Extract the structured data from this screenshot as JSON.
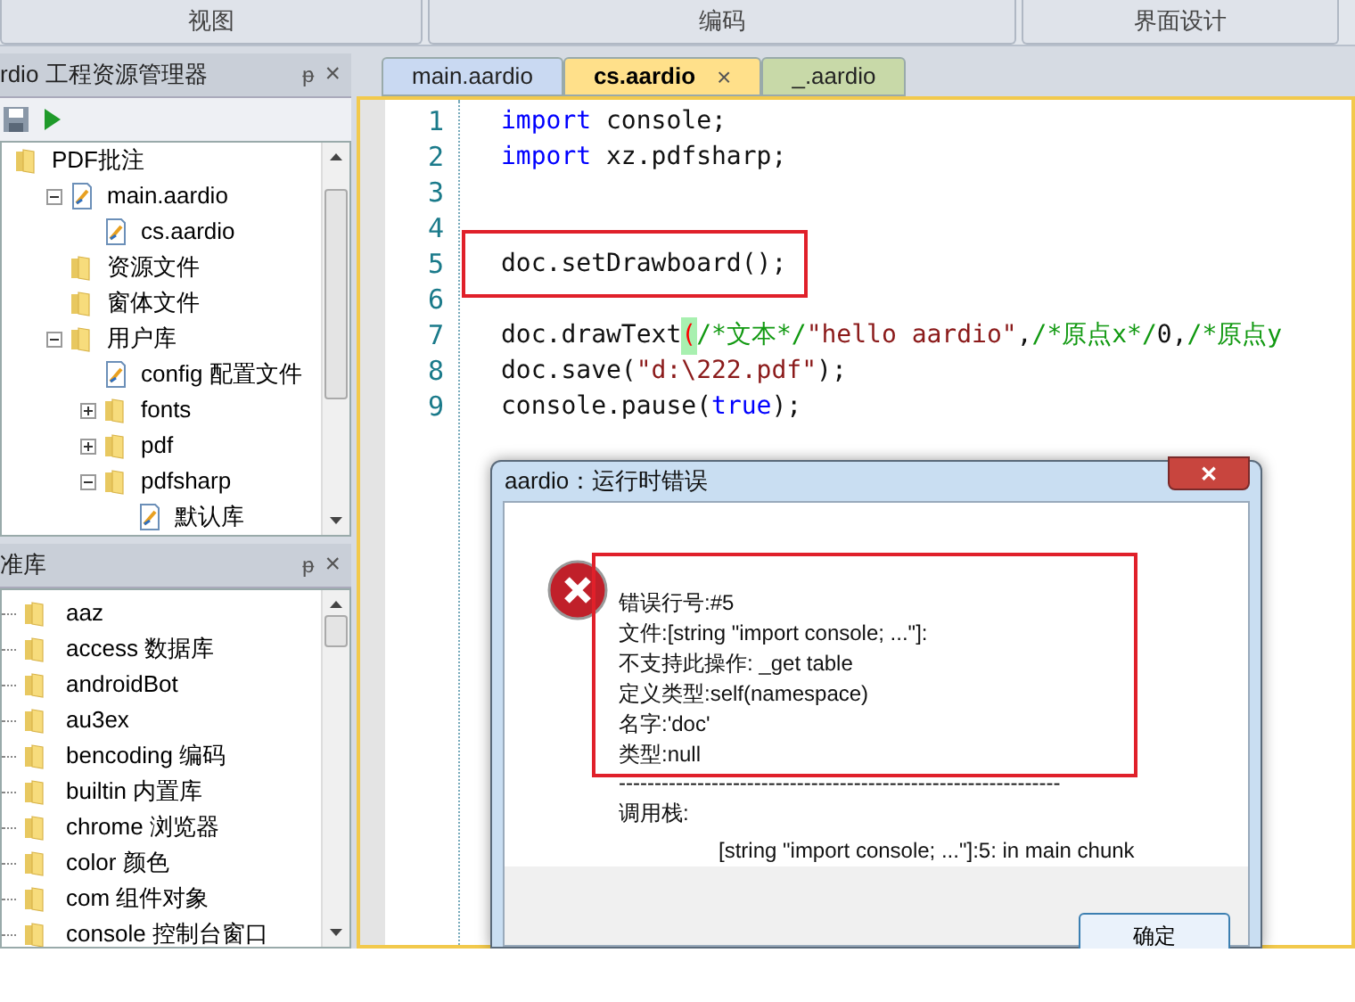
{
  "ribbon_groups": [
    {
      "label": "视图"
    },
    {
      "label": "编码"
    },
    {
      "label": "界面设计"
    }
  ],
  "project_panel": {
    "title": "rdio 工程资源管理器",
    "pin": "ᵽ",
    "close": "×",
    "tree": [
      {
        "label": "PDF批注",
        "kind": "folder",
        "children": [
          {
            "label": "main.aardio",
            "kind": "file",
            "expanded": true,
            "children": [
              {
                "label": "cs.aardio",
                "kind": "file"
              }
            ]
          },
          {
            "label": "资源文件",
            "kind": "folder"
          },
          {
            "label": "窗体文件",
            "kind": "folder"
          },
          {
            "label": "用户库",
            "kind": "folder",
            "expanded": true,
            "children": [
              {
                "label": "config 配置文件",
                "kind": "file"
              },
              {
                "label": "fonts",
                "kind": "folder",
                "expanded": false
              },
              {
                "label": "pdf",
                "kind": "folder",
                "expanded": false
              },
              {
                "label": "pdfsharp",
                "kind": "folder",
                "expanded": true,
                "children": [
                  {
                    "label": "默认库",
                    "kind": "file"
                  }
                ]
              }
            ]
          }
        ]
      }
    ]
  },
  "library_panel": {
    "title": "准库",
    "pin": "ᵽ",
    "close": "×",
    "items": [
      {
        "label": "aaz"
      },
      {
        "label": "access 数据库"
      },
      {
        "label": "androidBot"
      },
      {
        "label": "au3ex"
      },
      {
        "label": "bencoding 编码"
      },
      {
        "label": "builtin 内置库"
      },
      {
        "label": "chrome 浏览器"
      },
      {
        "label": "color 颜色"
      },
      {
        "label": "com 组件对象"
      },
      {
        "label": "console 控制台窗口"
      }
    ]
  },
  "tabs": [
    {
      "label": "main.aardio",
      "selected": false,
      "color": "#c9d9f2"
    },
    {
      "label": "cs.aardio",
      "selected": true,
      "color": "#ffe08a",
      "close": "×"
    },
    {
      "label": "_.aardio",
      "selected": false,
      "color": "#c8d9a8"
    }
  ],
  "editor": {
    "lines": [
      {
        "number": "1",
        "tokens": [
          {
            "kind": "keyword",
            "text": "import"
          },
          {
            "kind": "plain",
            "text": " console;"
          }
        ]
      },
      {
        "number": "2",
        "tokens": [
          {
            "kind": "keyword",
            "text": "import"
          },
          {
            "kind": "plain",
            "text": " xz.pdfsharp;"
          }
        ]
      },
      {
        "number": "3"
      },
      {
        "number": "4"
      },
      {
        "number": "5",
        "tokens": [
          {
            "kind": "plain",
            "text": "doc.setDrawboard();"
          }
        ],
        "highlighted": true
      },
      {
        "number": "6"
      },
      {
        "number": "7",
        "tokens": [
          {
            "kind": "plain",
            "text": "doc.drawText"
          },
          {
            "kind": "match",
            "text": "("
          },
          {
            "kind": "comment",
            "text": "/*文本*/"
          },
          {
            "kind": "string",
            "text": "\"hello aardio\""
          },
          {
            "kind": "plain",
            "text": ","
          },
          {
            "kind": "comment",
            "text": "/*原点x*/"
          },
          {
            "kind": "plain",
            "text": "0,"
          },
          {
            "kind": "comment",
            "text": "/*原点y"
          }
        ]
      },
      {
        "number": "8",
        "tokens": [
          {
            "kind": "plain",
            "text": "doc.save("
          },
          {
            "kind": "string",
            "text": "\"d:\\222.pdf\""
          },
          {
            "kind": "plain",
            "text": ");"
          }
        ]
      },
      {
        "number": "9",
        "tokens": [
          {
            "kind": "plain",
            "text": "console.pause("
          },
          {
            "kind": "keyword",
            "text": "true"
          },
          {
            "kind": "plain",
            "text": ");"
          }
        ]
      }
    ]
  },
  "dialog": {
    "title": "aardio：运行时错误",
    "close": "✕",
    "message": [
      "错误行号:#5",
      "文件:[string \"import console; ...\"]:",
      "不支持此操作: _get table",
      "定义类型:self(namespace)",
      "名字:'doc'",
      "类型:null"
    ],
    "separator": "--------------------------------------------------------------",
    "stack_label": "调用栈:",
    "stack_line": "[string \"import console; ...\"]:5: in main chunk",
    "button": "确定"
  }
}
